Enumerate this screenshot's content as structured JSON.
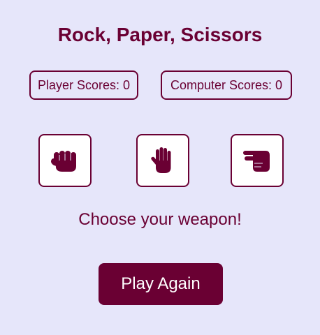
{
  "game": {
    "title": "Rock, Paper, Scissors",
    "message": "Choose your weapon!",
    "play_again_label": "Play Again"
  },
  "scores": {
    "player": "Player Scores: 0",
    "computer": "Computer Scores: 0"
  },
  "choices": [
    {
      "id": "rock",
      "icon": "fist-icon"
    },
    {
      "id": "paper",
      "icon": "open-hand-icon"
    },
    {
      "id": "scissors",
      "icon": "scissors-hand-icon"
    }
  ],
  "colors": {
    "background": "#e6e6fa",
    "accent": "#6a0033",
    "button_text": "#ffffff",
    "card_background": "#ffffff"
  }
}
